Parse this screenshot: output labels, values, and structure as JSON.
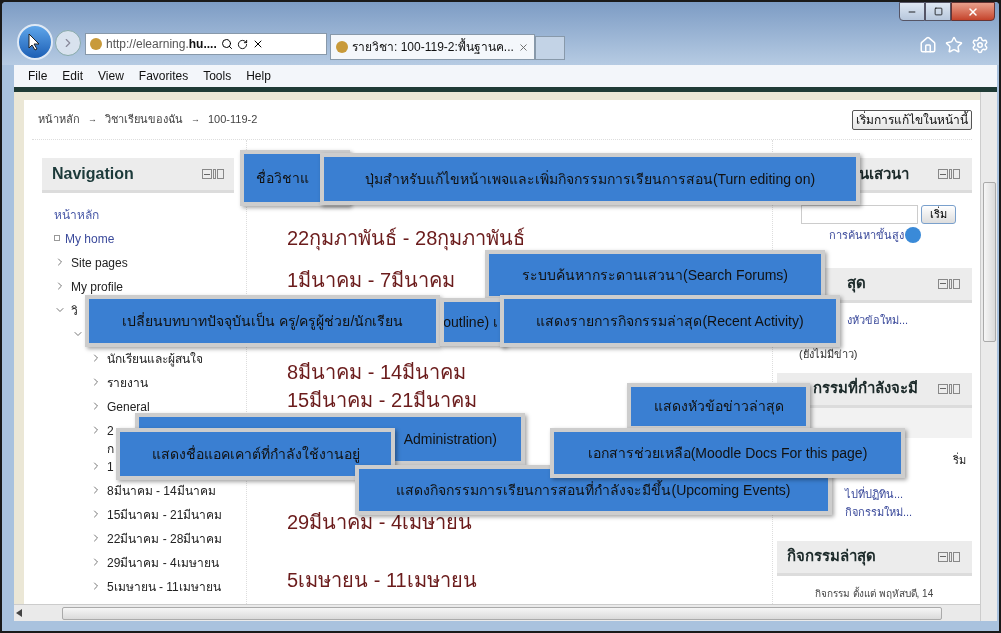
{
  "browser": {
    "address_prefix": "http://elearning.",
    "address_bold": "hu....",
    "tab_title": "รายวิชา: 100-119-2:พื้นฐานค...",
    "menu": [
      "File",
      "Edit",
      "View",
      "Favorites",
      "Tools",
      "Help"
    ]
  },
  "breadcrumb": [
    {
      "kind": "link",
      "label": "หน้าหลัก"
    },
    {
      "kind": "separator",
      "label": "→"
    },
    {
      "kind": "link",
      "label": "วิชาเรียนของฉัน"
    },
    {
      "kind": "separator",
      "label": "→"
    },
    {
      "kind": "link",
      "label": "100-119-2"
    }
  ],
  "edit_button": "เริ่มการแก้ไขในหน้านี้",
  "navigation": {
    "title": "Navigation",
    "items": [
      {
        "kind": "root",
        "label": "หน้าหลัก"
      },
      {
        "kind": "leaf",
        "label": "My home"
      },
      {
        "kind": "branch",
        "label": "Site pages",
        "expanded": false
      },
      {
        "kind": "branch",
        "label": "My profile",
        "expanded": false
      },
      {
        "kind": "branch",
        "label": "วิ",
        "expanded": true,
        "children": [
          {
            "kind": "branch",
            "expanded": true,
            "children": [
              {
                "kind": "branch",
                "label": "นักเรียนและผู้สนใจ",
                "expanded": false
              },
              {
                "kind": "branch",
                "label": "รายงาน",
                "expanded": false
              },
              {
                "kind": "branch",
                "label": "General",
                "expanded": false
              },
              {
                "kind": "branch",
                "label": "2",
                "label_line2": "ก",
                "expanded": false
              },
              {
                "kind": "branch",
                "label": "1",
                "expanded": false
              },
              {
                "kind": "branch",
                "label": "8มีนาคม - 14มีนาคม",
                "expanded": false
              },
              {
                "kind": "branch",
                "label": "15มีนาคม - 21มีนาคม",
                "expanded": false
              },
              {
                "kind": "branch",
                "label": "22มีนาคม - 28มีนาคม",
                "expanded": false
              },
              {
                "kind": "branch",
                "label": "29มีนาคม - 4เมษายน",
                "expanded": false
              },
              {
                "kind": "branch",
                "label": "5เมษายน - 11เมษายน",
                "expanded": false
              }
            ]
          }
        ]
      }
    ]
  },
  "sections": [
    {
      "title": "22กุมภาพันธ์ - 28กุมภาพันธ์"
    },
    {
      "title": "1มีนาคม - 7มีนาคม"
    },
    {
      "title": "8มีนาคม - 14มีนาคม"
    },
    {
      "title": "15มีนาคม - 21มีนาคม"
    },
    {
      "title": "29มีนาคม - 4เมษายน"
    },
    {
      "title": "5เมษายน - 11เมษายน"
    }
  ],
  "blocks": [
    {
      "kind": "search",
      "title": "นเสวนา",
      "button": "เริ่ม",
      "link": "การค้นหาขั้นสูง"
    },
    {
      "kind": "news",
      "title": "สุด",
      "lines": [
        "งหัวข้อใหม่...",
        "(ยังไม่มีข่าว)"
      ]
    },
    {
      "kind": "events",
      "title": "กรรมที่กำลังจะมี",
      "lines": [
        "ริ่ม"
      ],
      "links": [
        "ไปที่ปฏิทิน...",
        "กิจกรรมใหม่..."
      ]
    },
    {
      "kind": "recent",
      "title": "กิจกรรมล่าสุด",
      "lines": [
        "กิจกรรม ตั้งแต่ พฤหัสบดี, 14"
      ]
    }
  ],
  "callouts": [
    {
      "text": "ชื่อวิชาแ"
    },
    {
      "text": "ปุ่มสำหรับแก้ไขหน้าเพจและเพิ่มกิจกรรมการเรียนการสอน(Turn editing on)"
    },
    {
      "text": "ระบบค้นหากระดานเสวนา(Search  Forums)"
    },
    {
      "text": "เปลี่ยนบทบาทปัจจุบันเป็น ครู/ครูผู้ช่วย/นักเรียน"
    },
    {
      "text": "outline) เ"
    },
    {
      "text": "แสดงรายการกิจกรรมล่าสุด(Recent  Activity)"
    },
    {
      "text": "แสดงหัวข้อข่าวล่าสุด"
    },
    {
      "text": "Administration)"
    },
    {
      "text": "แสดงชื่อแอคเคาต์ที่กำลังใช้งานอยู่"
    },
    {
      "text": "เอกสารช่วยเหลือ(Moodle Docs For this page)"
    },
    {
      "text": "แสดงกิจกรรมการเรียนการสอนที่กำลังจะมีขึ้น(Upcoming Events)"
    }
  ]
}
